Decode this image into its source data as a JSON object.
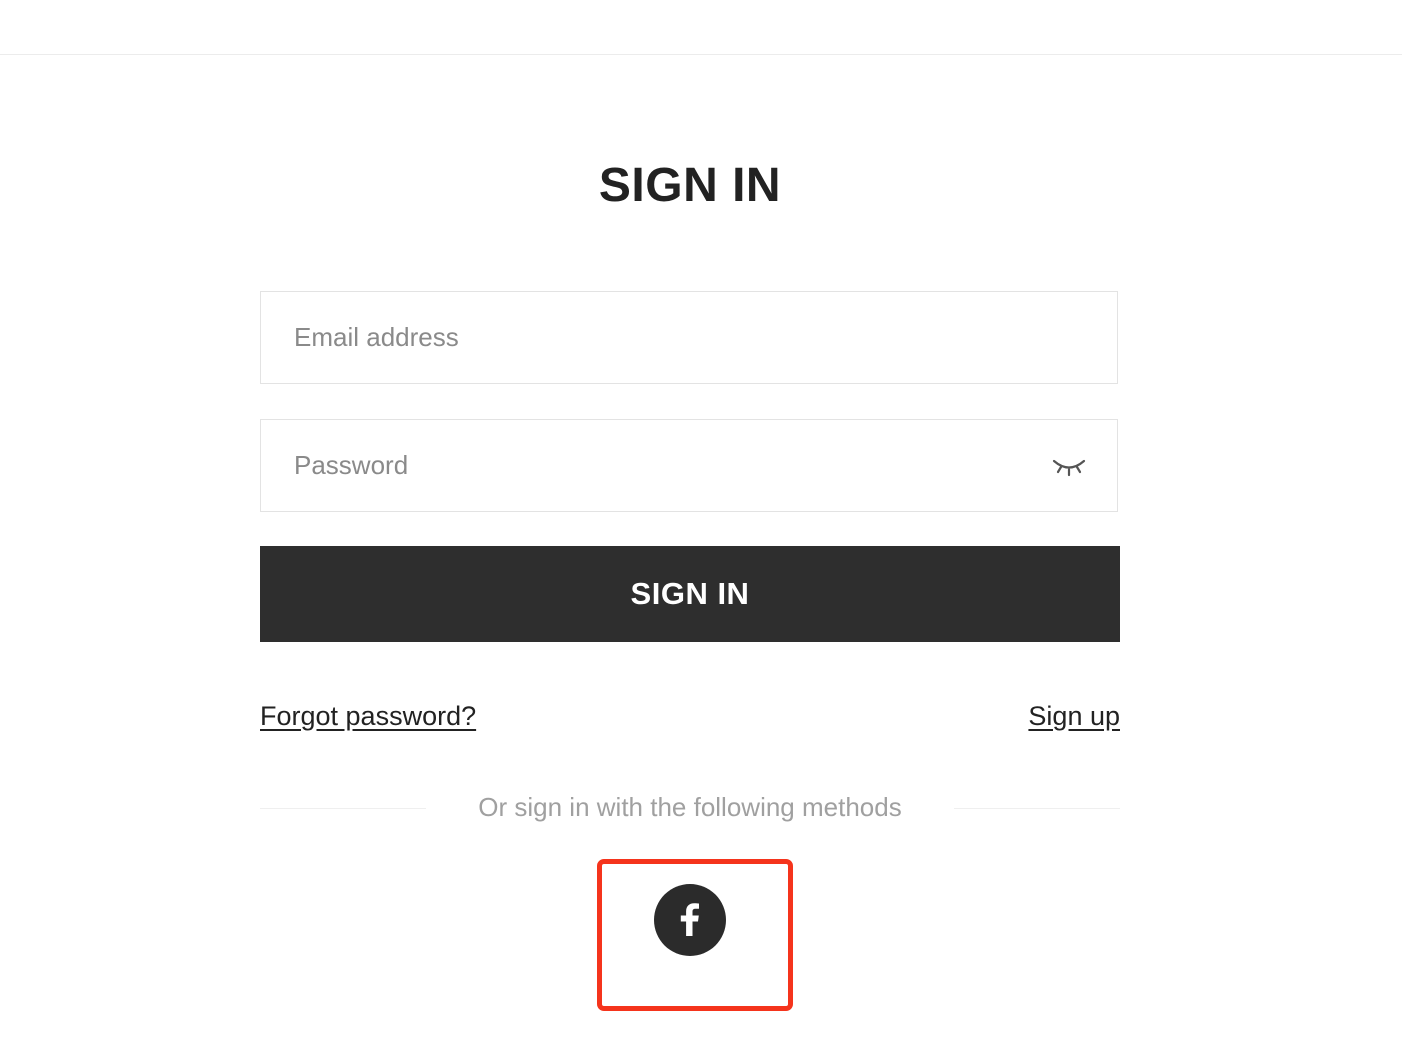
{
  "page": {
    "title": "SIGN IN"
  },
  "form": {
    "email_placeholder": "Email address",
    "password_placeholder": "Password",
    "show_password_icon": "closed-eye-icon",
    "submit_label": "SIGN IN"
  },
  "links": {
    "forgot_password": "Forgot password?",
    "sign_up": "Sign up"
  },
  "social": {
    "separator_text": "Or sign in with the following methods",
    "providers": [
      {
        "name": "facebook",
        "icon": "facebook-icon"
      }
    ]
  },
  "colors": {
    "primary_button": "#2e2e2e",
    "highlight_border": "#f5341c",
    "placeholder_text": "#8a8a8a",
    "muted_text": "#a0a0a0"
  }
}
